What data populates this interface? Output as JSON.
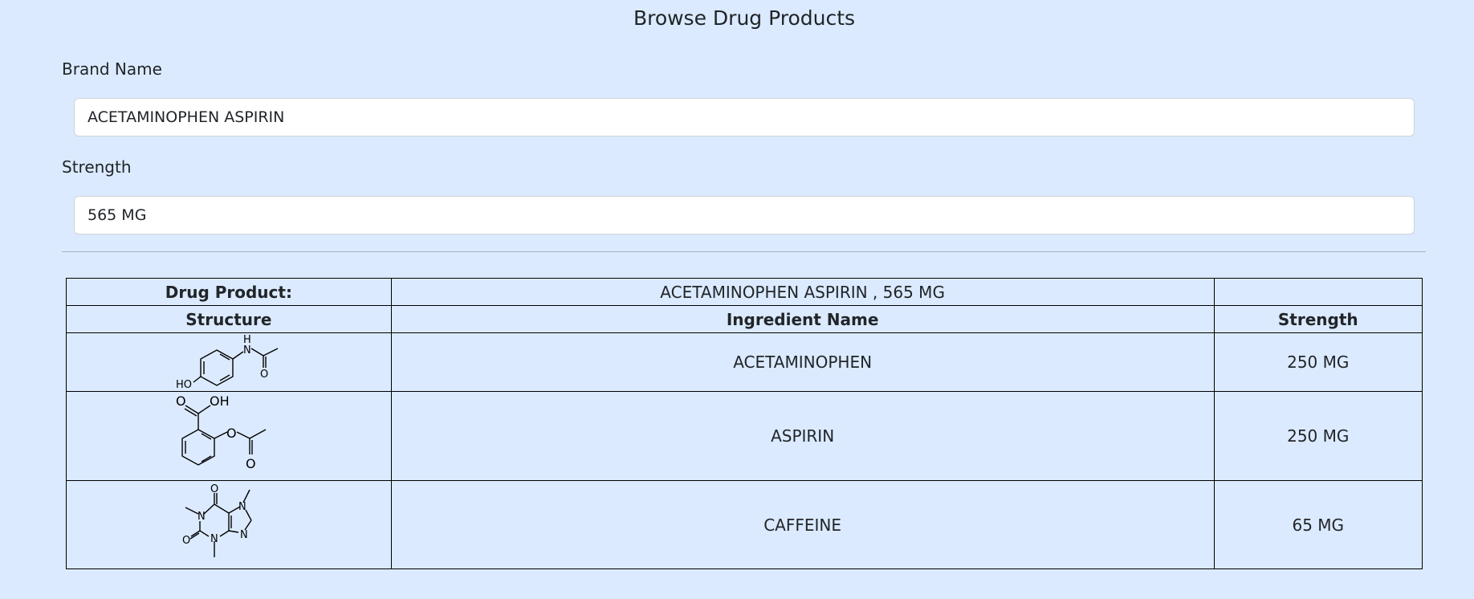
{
  "page": {
    "title": "Browse Drug Products"
  },
  "form": {
    "brand_label": "Brand Name",
    "brand_value": "ACETAMINOPHEN ASPIRIN",
    "strength_label": "Strength",
    "strength_value": "565 MG"
  },
  "table": {
    "product_label": "Drug Product:",
    "product_value": "ACETAMINOPHEN ASPIRIN , 565 MG",
    "headers": {
      "structure": "Structure",
      "ingredient": "Ingredient Name",
      "strength": "Strength"
    },
    "rows": [
      {
        "structure_icon": "acetaminophen-structure",
        "ingredient": "ACETAMINOPHEN",
        "strength": "250 MG",
        "atom_labels": [
          "H",
          "N",
          "O",
          "HO"
        ]
      },
      {
        "structure_icon": "aspirin-structure",
        "ingredient": "ASPIRIN",
        "strength": "250 MG",
        "atom_labels": [
          "O",
          "OH",
          "O",
          "O"
        ]
      },
      {
        "structure_icon": "caffeine-structure",
        "ingredient": "CAFFEINE",
        "strength": "65 MG",
        "atom_labels": [
          "O",
          "N",
          "N",
          "O",
          "N",
          "N"
        ]
      }
    ]
  }
}
